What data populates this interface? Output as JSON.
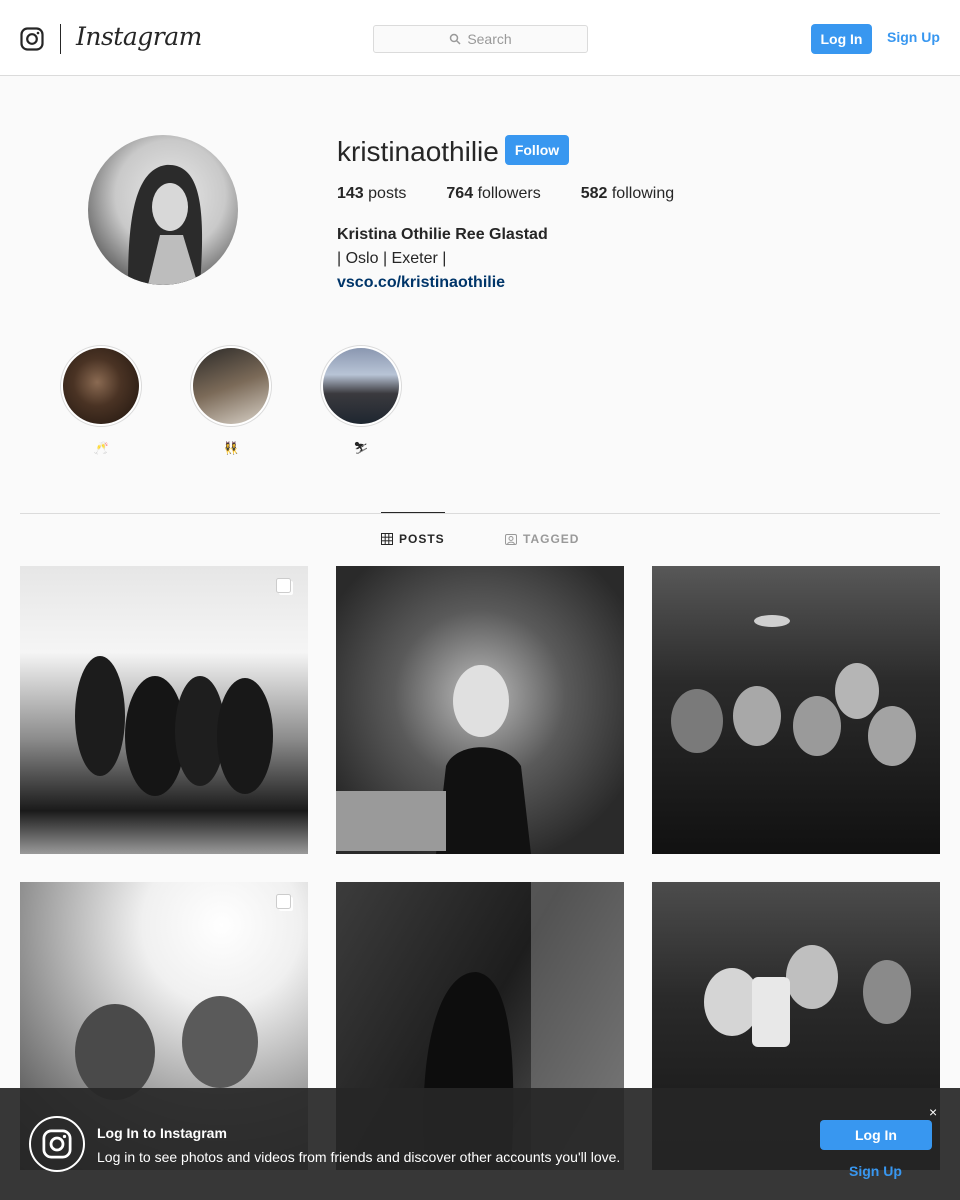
{
  "nav": {
    "brand": "Instagram",
    "search_placeholder": "Search",
    "login_label": "Log In",
    "signup_label": "Sign Up"
  },
  "profile": {
    "username": "kristinaothilie",
    "follow_label": "Follow",
    "stats": [
      {
        "count": "143",
        "label": "posts"
      },
      {
        "count": "764",
        "label": "followers"
      },
      {
        "count": "582",
        "label": "following"
      }
    ],
    "full_name": "Kristina Othilie Ree Glastad",
    "bio": "| Oslo | Exeter |",
    "link": "vsco.co/kristinaothilie"
  },
  "highlights": [
    {
      "label": "🥂"
    },
    {
      "label": "👯‍♀️"
    },
    {
      "label": "⛷"
    }
  ],
  "tabs": {
    "posts": "POSTS",
    "tagged": "TAGGED"
  },
  "banner": {
    "title": "Log In to Instagram",
    "text": "Log in to see photos and videos from friends and discover other accounts you'll love.",
    "login_label": "Log In",
    "signup_label": "Sign Up",
    "close_label": "×"
  },
  "icons": {
    "camera": "instagram-camera-icon",
    "search": "search-icon",
    "grid": "grid-icon",
    "tagged": "tagged-icon",
    "multi": "carousel-icon",
    "close": "close-icon"
  },
  "colors": {
    "accent": "#3897f0",
    "link": "#003569",
    "border": "#dbdbdb"
  }
}
